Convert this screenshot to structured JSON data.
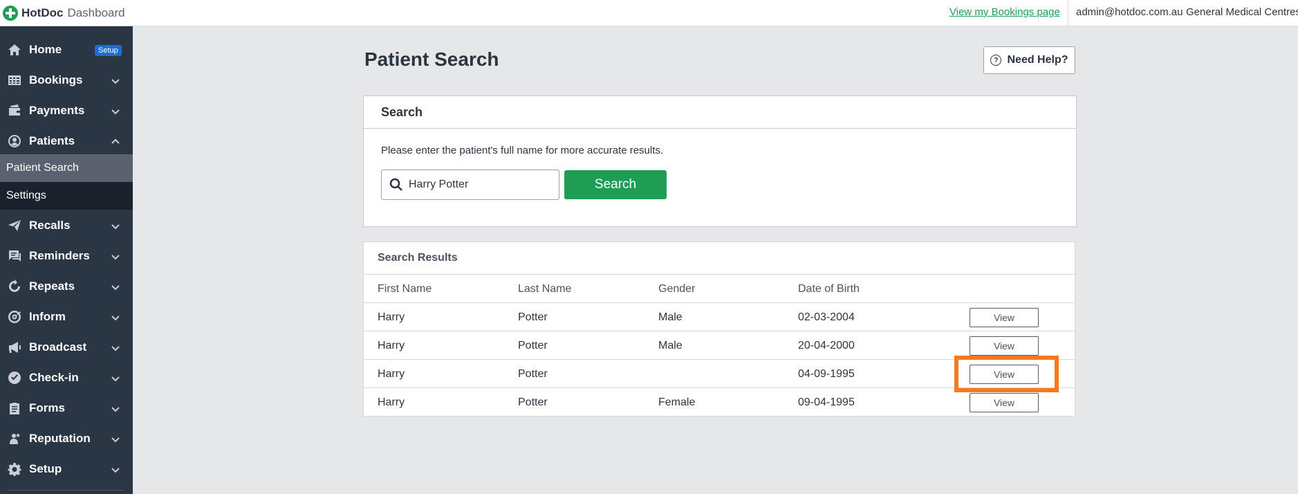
{
  "topbar": {
    "brand": "HotDoc",
    "brand_sub": "Dashboard",
    "bookings_link": "View my Bookings page",
    "user_email": "admin@hotdoc.com.au",
    "practice_name": "General Medical Centres"
  },
  "sidebar": {
    "items": [
      {
        "label": "Home",
        "icon": "home-icon",
        "badge": "Setup"
      },
      {
        "label": "Bookings",
        "icon": "calendar-grid-icon"
      },
      {
        "label": "Payments",
        "icon": "wallet-icon"
      },
      {
        "label": "Patients",
        "icon": "patient-icon",
        "expanded": true
      },
      {
        "label": "Recalls",
        "icon": "send-icon"
      },
      {
        "label": "Reminders",
        "icon": "message-icon"
      },
      {
        "label": "Repeats",
        "icon": "repeat-icon"
      },
      {
        "label": "Inform",
        "icon": "target-icon"
      },
      {
        "label": "Broadcast",
        "icon": "megaphone-icon"
      },
      {
        "label": "Check-in",
        "icon": "check-circle-icon"
      },
      {
        "label": "Forms",
        "icon": "clipboard-icon"
      },
      {
        "label": "Reputation",
        "icon": "person-star-icon"
      },
      {
        "label": "Setup",
        "icon": "gear-icon"
      }
    ],
    "sub_items": [
      {
        "label": "Patient Search",
        "active": true
      },
      {
        "label": "Settings",
        "active": false
      }
    ]
  },
  "main": {
    "title": "Patient Search",
    "help_button": "Need Help?",
    "search_panel": {
      "heading": "Search",
      "hint": "Please enter the patient's full name for more accurate results.",
      "input_value": "Harry Potter",
      "button_label": "Search"
    },
    "results": {
      "heading": "Search Results",
      "columns": [
        "First Name",
        "Last Name",
        "Gender",
        "Date of Birth"
      ],
      "rows": [
        {
          "first": "Harry",
          "last": "Potter",
          "gender": "Male",
          "dob": "02-03-2004",
          "action": "View"
        },
        {
          "first": "Harry",
          "last": "Potter",
          "gender": "Male",
          "dob": "20-04-2000",
          "action": "View"
        },
        {
          "first": "Harry",
          "last": "Potter",
          "gender": "",
          "dob": "04-09-1995",
          "action": "View"
        },
        {
          "first": "Harry",
          "last": "Potter",
          "gender": "Female",
          "dob": "09-04-1995",
          "action": "View"
        }
      ]
    }
  },
  "colors": {
    "accent_green": "#1f9d55",
    "sidebar_bg": "#2b3645",
    "highlight_orange": "#f47a20",
    "badge_blue": "#1a6fd6"
  }
}
